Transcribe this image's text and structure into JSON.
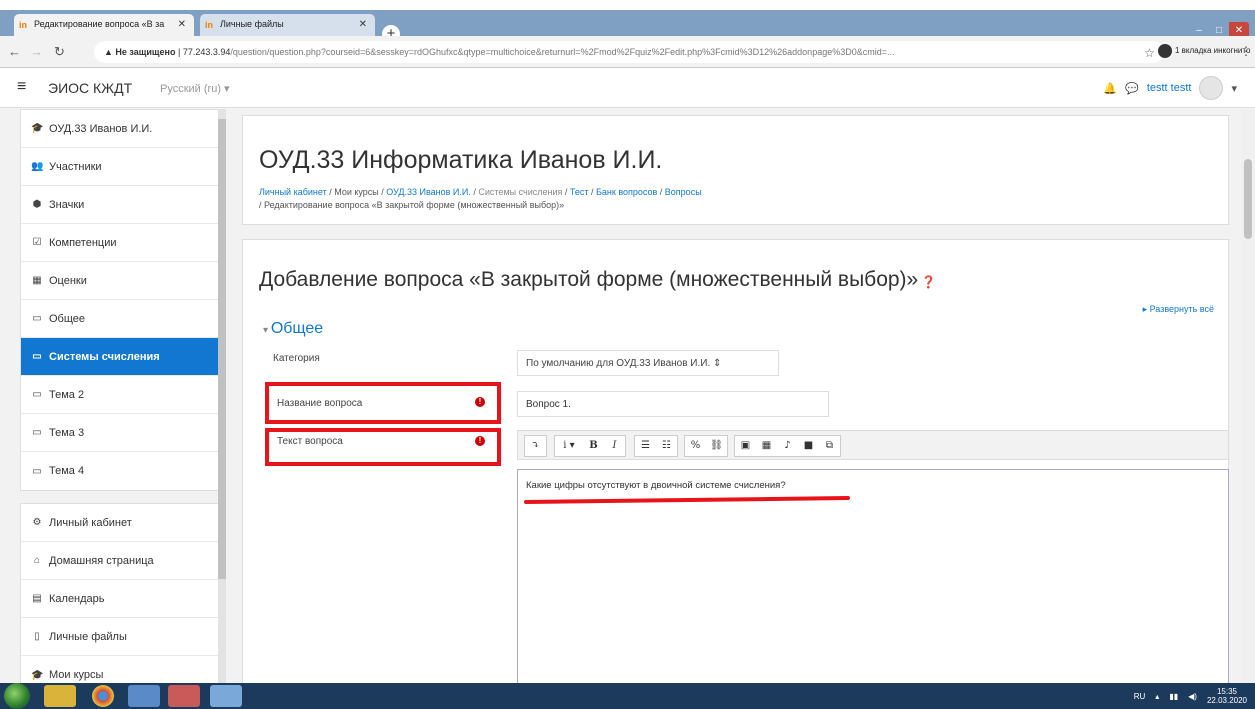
{
  "browser": {
    "tabs": [
      {
        "title": "Редактирование вопроса «В за",
        "active": true
      },
      {
        "title": "Личные файлы",
        "active": false
      }
    ],
    "new_tab": "+",
    "not_secure": "Не защищено",
    "url_host": "77.243.3.94",
    "url_path": "/question/question.php?courseid=6&sesskey=rdOGhufxc&qtype=multichoice&returnurl=%2Fmod%2Fquiz%2Fedit.php%3Fcmid%3D12%26addonpage%3D0&cmid=...",
    "incognito": "1 вкладка инкогнито"
  },
  "navbar": {
    "site_name": "ЭИОС КЖДТ",
    "language": "Русский (ru) ▾",
    "user_name": "testt testt"
  },
  "sidebar": {
    "group1": [
      {
        "label": "ОУД.33 Иванов И.И.",
        "icon": "graduation-cap-icon",
        "glyph": "🎓",
        "active": false
      },
      {
        "label": "Участники",
        "icon": "users-icon",
        "glyph": "👥",
        "active": false
      },
      {
        "label": "Значки",
        "icon": "shield-icon",
        "glyph": "⬢",
        "active": false
      },
      {
        "label": "Компетенции",
        "icon": "checkbox-icon",
        "glyph": "☑",
        "active": false
      },
      {
        "label": "Оценки",
        "icon": "table-icon",
        "glyph": "▦",
        "active": false
      },
      {
        "label": "Общее",
        "icon": "folder-icon",
        "glyph": "▭",
        "active": false
      },
      {
        "label": "Системы счисления",
        "icon": "folder-icon",
        "glyph": "▭",
        "active": true
      },
      {
        "label": "Тема 2",
        "icon": "folder-icon",
        "glyph": "▭",
        "active": false
      },
      {
        "label": "Тема 3",
        "icon": "folder-icon",
        "glyph": "▭",
        "active": false
      },
      {
        "label": "Тема 4",
        "icon": "folder-icon",
        "glyph": "▭",
        "active": false
      }
    ],
    "group2": [
      {
        "label": "Личный кабинет",
        "icon": "dashboard-icon",
        "glyph": "⚙"
      },
      {
        "label": "Домашняя страница",
        "icon": "home-icon",
        "glyph": "⌂"
      },
      {
        "label": "Календарь",
        "icon": "calendar-icon",
        "glyph": "▤"
      },
      {
        "label": "Личные файлы",
        "icon": "file-icon",
        "glyph": "▯"
      },
      {
        "label": "Мои курсы",
        "icon": "graduation-cap-icon",
        "glyph": "🎓"
      }
    ]
  },
  "header": {
    "course_title": "ОУД.33 Информатика Иванов И.И.",
    "breadcrumbs": [
      "Личный кабинет",
      "Мои курсы",
      "ОУД.33 Иванов И.И.",
      "Системы счисления",
      "Тест",
      "Банк вопросов",
      "Вопросы"
    ],
    "breadcrumb_current": "Редактирование вопроса «В закрытой форме (множественный выбор)»",
    "separator": " / "
  },
  "form": {
    "title": "Добавление вопроса «В закрытой форме (множественный выбор)»",
    "expand_all": "▸ Развернуть всё",
    "section": "Общее",
    "category_label": "Категория",
    "category_value": "По умолчанию для ОУД.33 Иванов И.И.   ⇕",
    "name_label": "Название вопроса",
    "name_value": "Вопрос 1.",
    "text_label": "Текст вопроса",
    "text_value": "Какие цифры отсутствуют в двоичной системе счисления?",
    "toolbar": {
      "toggle": "⤵",
      "info": "i ▾",
      "bold": "B",
      "italic": "I",
      "ul": "☰",
      "ol": "☷",
      "link": "%",
      "unlink": "⛓",
      "image": "▣",
      "media": "▦",
      "audio": "♪",
      "video": "■",
      "manage": "⧉"
    }
  },
  "taskbar": {
    "lang": "RU",
    "time": "15:35",
    "date": "22.03.2020"
  },
  "colors": {
    "accent": "#1177d1",
    "highlight_red": "#e8141c",
    "tabbar": "#7f9fc3"
  }
}
